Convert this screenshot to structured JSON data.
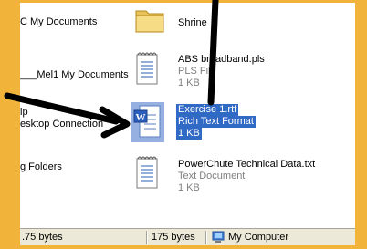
{
  "left_column": {
    "items": [
      {
        "label": "C My Documents"
      },
      {
        "label": "___Mel1 My Documents"
      },
      {
        "label": "lp"
      },
      {
        "label": "esktop Connection"
      },
      {
        "label": "g Folders"
      }
    ]
  },
  "files": [
    {
      "name": "Shrine",
      "type": "",
      "size": "",
      "icon": "folder-icon"
    },
    {
      "name": "ABS broadband.pls",
      "type": "PLS File",
      "size": "1 KB",
      "icon": "text-file-icon"
    },
    {
      "name": "Exercise 1.rtf",
      "type": "Rich Text Format",
      "size": "1 KB",
      "icon": "word-document-icon",
      "selected": true
    },
    {
      "name": "PowerChute Technical Data.txt",
      "type": "Text Document",
      "size": "1 KB",
      "icon": "text-file-icon"
    }
  ],
  "status": {
    "size_left": ".75 bytes",
    "size_right": "175 bytes",
    "zone": "My Computer",
    "zone_icon": "computer-icon"
  },
  "colors": {
    "frame": "#f1b33a",
    "selection": "#316ac5",
    "arrow": "#000000"
  }
}
